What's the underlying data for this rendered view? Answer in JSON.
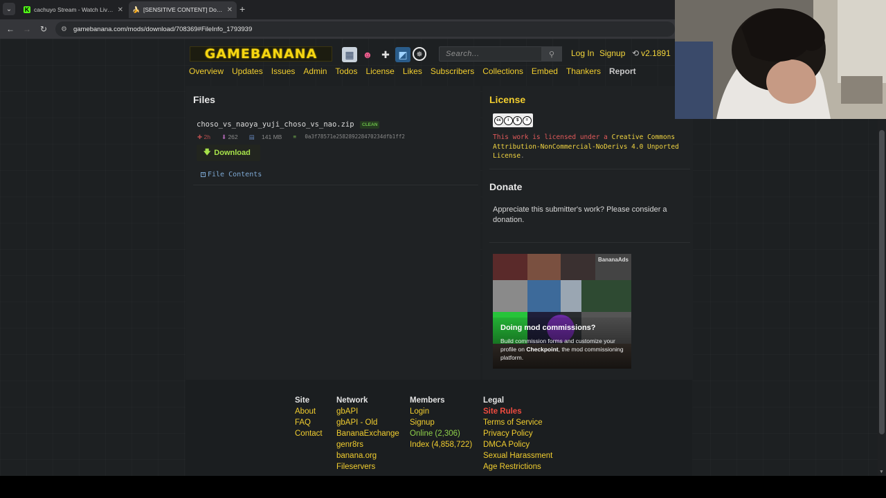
{
  "browser": {
    "tabs": [
      {
        "title": "cachuyo Stream - Watch Live o",
        "favicon": "kick-icon",
        "active": false
      },
      {
        "title": "[SENSITIVE CONTENT] Downlo",
        "favicon": "banana-icon",
        "active": true
      }
    ],
    "url": "gamebanana.com/mods/download/708369#FileInfo_1793939"
  },
  "header": {
    "logo_text": "GAMEBANANA",
    "search_placeholder": "Search...",
    "login": "Log In",
    "signup": "Signup",
    "version": "v2.1891"
  },
  "subnav": [
    "Overview",
    "Updates",
    "Issues",
    "Admin",
    "Todos",
    "License",
    "Likes",
    "Subscribers",
    "Collections",
    "Embed",
    "Thankers",
    "Report"
  ],
  "files": {
    "title": "Files",
    "file_name": "choso_vs_naoya_yuji_choso_vs_nao.zip",
    "status": "CLEAN",
    "age": "2h",
    "downloads": "262",
    "size": "141 MB",
    "hash": "0a3f78571e258289228470234dfb1ff2",
    "download_label": "Download",
    "contents_label": "File Contents"
  },
  "license": {
    "title": "License",
    "badge_symbols": [
      "cc",
      "by",
      "nc",
      "nd"
    ],
    "text_before": "This work is licensed under a ",
    "link_text": "Creative Commons Attribution-NonCommercial-NoDerivs 4.0 Unported License",
    "text_after": "."
  },
  "donate": {
    "title": "Donate",
    "text": "Appreciate this submitter's work? Please consider a donation."
  },
  "ad": {
    "label": "BananaAds",
    "title": "Doing mod commissions?",
    "desc_before": "Build commission forms and customize your profile on ",
    "desc_bold": "Checkpoint",
    "desc_after": ", the mod commissioning platform."
  },
  "footer": {
    "site": {
      "heading": "Site",
      "links": [
        "About",
        "FAQ",
        "Contact"
      ]
    },
    "network": {
      "heading": "Network",
      "links": [
        "gbAPI",
        "gbAPI - Old",
        "BananaExchange",
        "genr8rs",
        "banana.org",
        "Fileservers"
      ]
    },
    "members": {
      "heading": "Members",
      "links": [
        "Login",
        "Signup",
        "Online (2,306)",
        "Index (4,858,722)"
      ]
    },
    "legal": {
      "heading": "Legal",
      "links": [
        "Site Rules",
        "Terms of Service",
        "Privacy Policy",
        "DMCA Policy",
        "Sexual Harassment",
        "Age Restrictions"
      ]
    }
  },
  "colors": {
    "accent_yellow": "#f2ce2f",
    "download_green": "#a7e24a",
    "license_red": "#e25a5a",
    "site_rules_red": "#ef4b3f"
  }
}
